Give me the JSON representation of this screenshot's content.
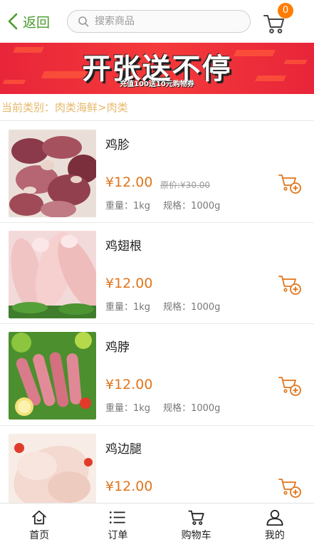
{
  "header": {
    "back_label": "返回",
    "search_placeholder": "搜索商品",
    "cart_count": "0"
  },
  "banner": {
    "title": "开张送不停",
    "subtitle": "充值100送10元购物券"
  },
  "category": {
    "text": "当前类别：肉类海鲜>肉类"
  },
  "products": [
    {
      "name": "鸡胗",
      "price": "¥12.00",
      "original_price": "原价:¥30.00",
      "weight": "重量：1kg",
      "spec": "规格：1000g",
      "image": "chicken-gizzard"
    },
    {
      "name": "鸡翅根",
      "price": "¥12.00",
      "original_price": "",
      "weight": "重量：1kg",
      "spec": "规格：1000g",
      "image": "chicken-drumette"
    },
    {
      "name": "鸡脖",
      "price": "¥12.00",
      "original_price": "",
      "weight": "重量：1kg",
      "spec": "规格：1000g",
      "image": "chicken-neck"
    },
    {
      "name": "鸡边腿",
      "price": "¥12.00",
      "original_price": "",
      "weight": "",
      "spec": "",
      "image": "chicken-leg"
    }
  ],
  "bottom_nav": {
    "items": [
      {
        "label": "首页",
        "icon": "home-icon"
      },
      {
        "label": "订单",
        "icon": "list-icon"
      },
      {
        "label": "购物车",
        "icon": "cart-icon"
      },
      {
        "label": "我的",
        "icon": "user-icon"
      }
    ]
  },
  "colors": {
    "accent_green": "#4a9a2c",
    "price_orange": "#e0751c",
    "badge_orange": "#ff7d00",
    "banner_red": "#e8253a",
    "category_gold": "#e6b86b"
  }
}
